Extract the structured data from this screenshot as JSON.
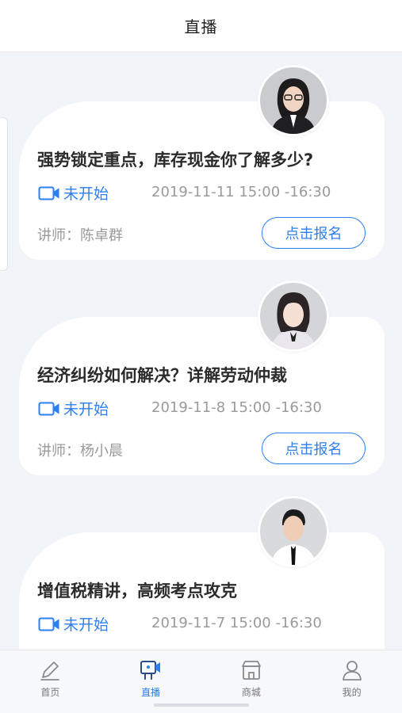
{
  "header": {
    "title": "直播"
  },
  "colors": {
    "accent": "#2d7ef0",
    "background": "#f1f4f9",
    "card": "#ffffff"
  },
  "courses": [
    {
      "title": "强势锁定重点，库存现金你了解多少?",
      "status": "未开始",
      "time": "2019-11-11 15:00 -16:30",
      "lecturer": "讲师：陈卓群",
      "button": "点击报名",
      "avatar": "female-lecturer-avatar"
    },
    {
      "title": "经济纠纷如何解决？详解劳动仲裁",
      "status": "未开始",
      "time": "2019-11-8 15:00 -16:30",
      "lecturer": "讲师：杨小晨",
      "button": "点击报名",
      "avatar": "female-lecturer-avatar"
    },
    {
      "title": "增值税精讲，高频考点攻克",
      "status": "未开始",
      "time": "2019-11-7 15:00 -16:30",
      "avatar": "male-lecturer-avatar"
    }
  ],
  "tabbar": {
    "items": [
      {
        "label": "首页",
        "icon": "pen-icon"
      },
      {
        "label": "直播",
        "icon": "live-camera-icon",
        "active": true
      },
      {
        "label": "商城",
        "icon": "store-icon"
      },
      {
        "label": "我的",
        "icon": "user-icon"
      }
    ]
  }
}
